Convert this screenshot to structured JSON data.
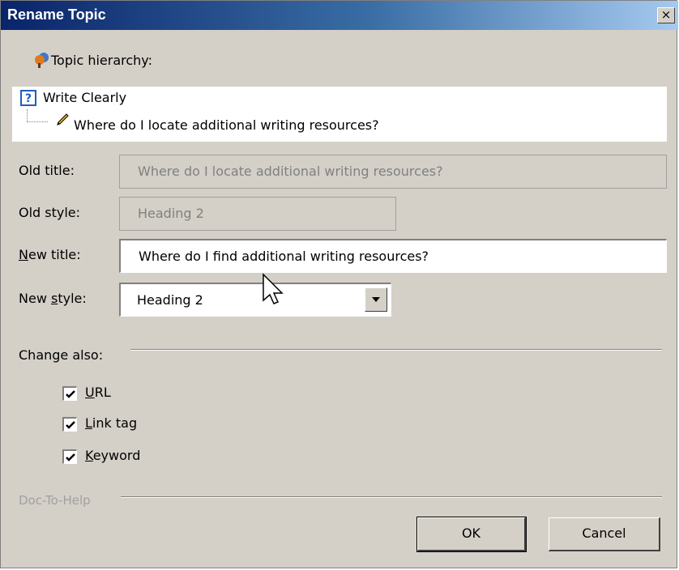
{
  "dialog": {
    "title": "Rename Topic",
    "close_label": "×"
  },
  "hierarchy": {
    "label": "Topic hierarchy:",
    "parent": "Write Clearly",
    "child": "Where do I locate additional writing resources?"
  },
  "form": {
    "old_title_label": "Old title:",
    "old_title_value": "Where do I locate additional writing resources?",
    "old_style_label": "Old style:",
    "old_style_value": "Heading 2",
    "new_title_label": "New title:",
    "new_title_value": "Where do I find additional writing resources?",
    "new_style_label": "New style:",
    "new_style_value": "Heading 2"
  },
  "change_also": {
    "label": "Change also:",
    "options": [
      {
        "label": "URL",
        "checked": true
      },
      {
        "label": "Link tag",
        "checked": true
      },
      {
        "label": "Keyword",
        "checked": true
      }
    ]
  },
  "footer": {
    "brand": "Doc-To-Help",
    "ok_label": "OK",
    "cancel_label": "Cancel"
  }
}
